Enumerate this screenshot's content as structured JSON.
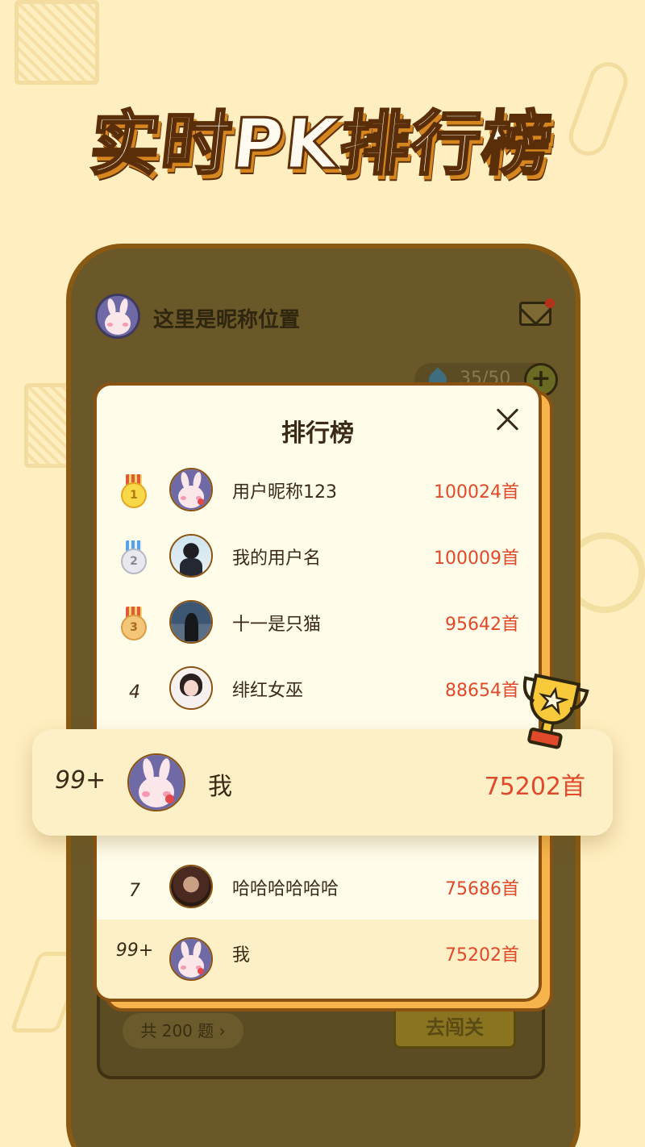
{
  "headline": "实时PK排行榜",
  "phone": {
    "nickname": "这里是昵称位置",
    "energy": "35/50",
    "plus_label": "+",
    "total_questions": "共 200 题 ›",
    "go_button": "去闯关"
  },
  "modal": {
    "title": "排行榜",
    "rows": [
      {
        "rank": "1",
        "name": "用户昵称123",
        "score": "100024首",
        "medal": "gold",
        "avatar": "rabbit-avatar"
      },
      {
        "rank": "2",
        "name": "我的用户名",
        "score": "100009首",
        "medal": "silver",
        "avatar": "woman-photo-avatar"
      },
      {
        "rank": "3",
        "name": "十一是只猫",
        "score": "95642首",
        "medal": "bronze",
        "avatar": "sea-photo-avatar"
      },
      {
        "rank": "4",
        "name": "绯红女巫",
        "score": "88654首",
        "avatar": "illustration-avatar"
      },
      {
        "rank": "7",
        "name": "哈哈哈哈哈哈",
        "score": "75686首",
        "avatar": "portrait-avatar"
      },
      {
        "rank": "99+",
        "name": "我",
        "score": "75202首",
        "avatar": "rabbit-avatar"
      }
    ]
  },
  "highlight": {
    "rank": "99+",
    "name": "我",
    "score": "75202首"
  },
  "colors": {
    "background": "#ffeebf",
    "score_red": "#e0492a",
    "accent_orange": "#f7b44d",
    "border_brown": "#8a5212"
  }
}
